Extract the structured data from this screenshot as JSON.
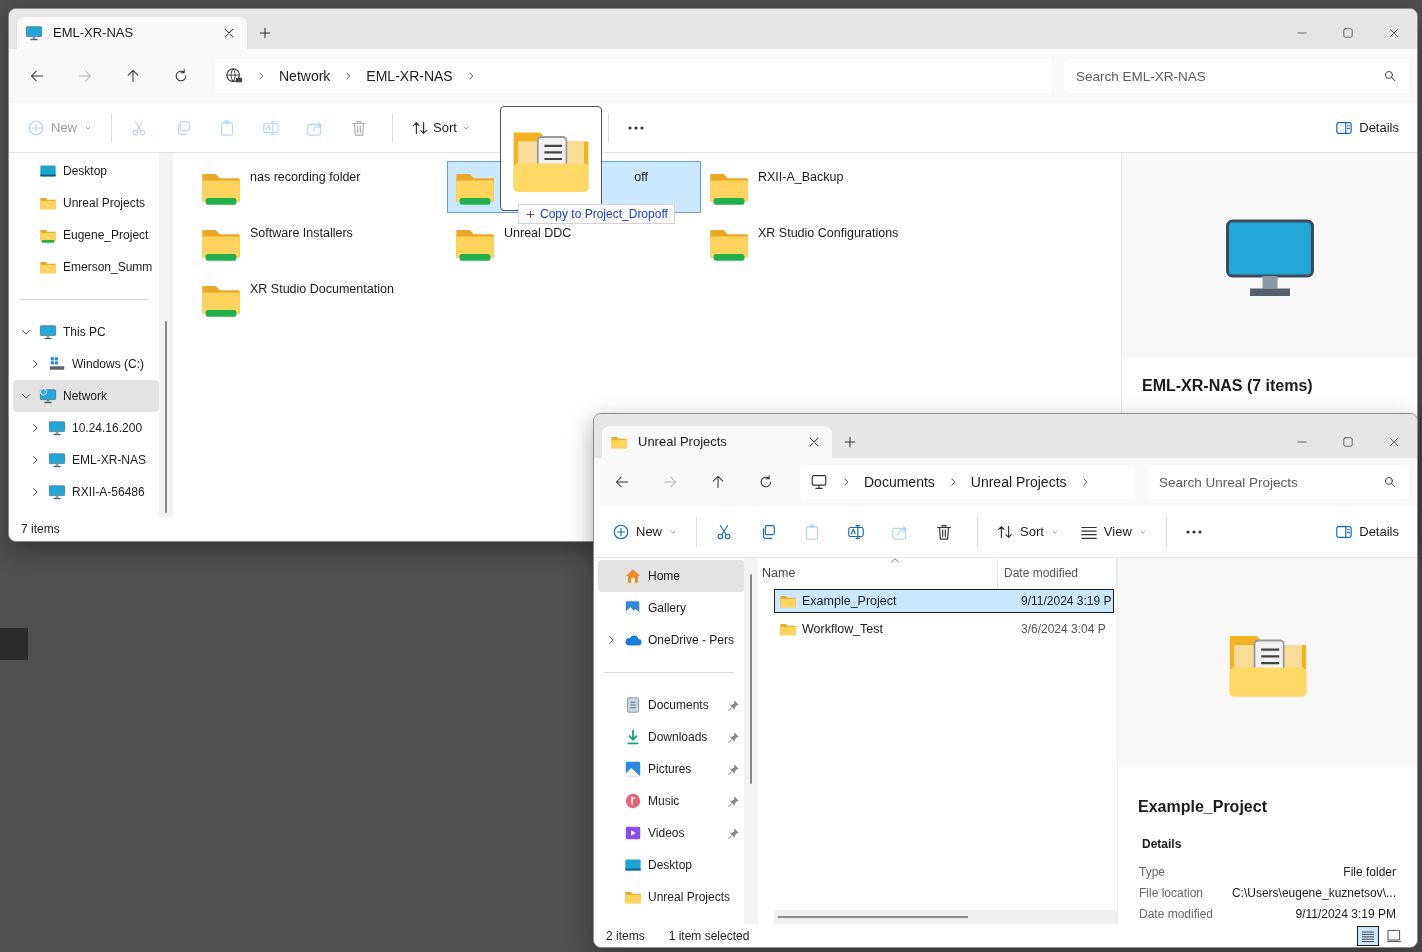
{
  "nas_window": {
    "tab": {
      "title": "EML-XR-NAS",
      "kind": "pc"
    },
    "nav_buttons": [
      {
        "kind": "back",
        "disabled": false
      },
      {
        "kind": "forward",
        "disabled": true
      },
      {
        "kind": "up",
        "disabled": false
      },
      {
        "kind": "refresh",
        "disabled": false
      }
    ],
    "breadcrumb": {
      "kind": "globe",
      "segments": [
        "Network",
        "EML-XR-NAS"
      ]
    },
    "search": {
      "placeholder": "Search EML-XR-NAS"
    },
    "command_groups": [
      [
        {
          "kind": "new",
          "label": "New",
          "disabled": true
        }
      ],
      [
        {
          "kind": "cut",
          "disabled": true
        },
        {
          "kind": "copy",
          "disabled": true
        },
        {
          "kind": "paste",
          "disabled": true
        },
        {
          "kind": "rename",
          "disabled": true
        },
        {
          "kind": "share",
          "disabled": true
        },
        {
          "kind": "delete",
          "disabled": true
        }
      ],
      [
        {
          "kind": "sort",
          "label": "Sort",
          "disabled": false
        }
      ],
      [
        {
          "kind": "more",
          "disabled": false
        }
      ]
    ],
    "details_button": {
      "label": "Details"
    },
    "sidebar": {
      "quick_access": [
        {
          "label": "Desktop",
          "kind": "desktop",
          "selected": false
        },
        {
          "label": "Unreal Projects",
          "kind": "folder",
          "selected": false
        },
        {
          "label": "Eugene_Project",
          "kind": "netfolder",
          "selected": false
        },
        {
          "label": "Emerson_Summ",
          "kind": "folder",
          "selected": false
        }
      ],
      "tree": [
        {
          "label": "This PC",
          "kind": "pc",
          "selected": false,
          "expanded": true,
          "children": [
            {
              "label": "Windows (C:)",
              "kind": "drive",
              "selected": false,
              "expanded": false
            }
          ]
        },
        {
          "label": "Network",
          "kind": "network",
          "selected": true,
          "expanded": true,
          "children": [
            {
              "label": "10.24.16.200",
              "kind": "pc",
              "selected": false,
              "expanded": false
            },
            {
              "label": "EML-XR-NAS",
              "kind": "pc",
              "selected": false,
              "expanded": false
            },
            {
              "label": "RXII-A-56486",
              "kind": "pc",
              "selected": false,
              "expanded": false
            }
          ]
        }
      ]
    },
    "tiles": [
      {
        "label": "nas recording folder",
        "selected": false
      },
      {
        "label": "off",
        "selected": true
      },
      {
        "label": "RXII-A_Backup",
        "selected": false
      },
      {
        "label": "Software Installers",
        "selected": false
      },
      {
        "label": "Unreal DDC",
        "selected": false
      },
      {
        "label": "XR Studio Configurations",
        "selected": false
      },
      {
        "label": "XR Studio Documentation",
        "selected": false
      }
    ],
    "details_pane": {
      "kind": "pc",
      "title": "EML-XR-NAS (7 items)"
    },
    "status_bar": [
      "7 items"
    ]
  },
  "drag": {
    "tooltip": "Copy to Project_Dropoff"
  },
  "projects_window": {
    "tab": {
      "title": "Unreal Projects",
      "kind": "folder"
    },
    "nav_buttons": [
      {
        "kind": "back",
        "disabled": false
      },
      {
        "kind": "forward",
        "disabled": true
      },
      {
        "kind": "up",
        "disabled": false
      },
      {
        "kind": "refresh",
        "disabled": false
      }
    ],
    "breadcrumb": {
      "kind": "monitor",
      "segments": [
        "Documents",
        "Unreal Projects"
      ]
    },
    "search": {
      "placeholder": "Search Unreal Projects"
    },
    "command_groups": [
      [
        {
          "kind": "new",
          "label": "New",
          "disabled": false
        }
      ],
      [
        {
          "kind": "cut",
          "disabled": false
        },
        {
          "kind": "copy",
          "disabled": false
        },
        {
          "kind": "paste",
          "disabled": true
        },
        {
          "kind": "rename",
          "disabled": false
        },
        {
          "kind": "share",
          "disabled": true
        },
        {
          "kind": "delete",
          "disabled": false
        }
      ],
      [
        {
          "kind": "sort",
          "label": "Sort",
          "disabled": false
        },
        {
          "kind": "view",
          "label": "View",
          "disabled": false
        }
      ],
      [
        {
          "kind": "more",
          "disabled": false
        }
      ]
    ],
    "details_button": {
      "label": "Details"
    },
    "sidebar": {
      "quick_access": [
        {
          "label": "Home",
          "kind": "home",
          "selected": true
        },
        {
          "label": "Gallery",
          "kind": "gallery",
          "selected": false
        }
      ],
      "tree": [
        {
          "label": "OneDrive - Pers",
          "kind": "onedrive",
          "selected": false,
          "expanded": false
        }
      ],
      "pinned": [
        {
          "label": "Documents",
          "kind": "documents",
          "selected": false,
          "pinned": true
        },
        {
          "label": "Downloads",
          "kind": "downloads",
          "selected": false,
          "pinned": true
        },
        {
          "label": "Pictures",
          "kind": "pictures",
          "selected": false,
          "pinned": true
        },
        {
          "label": "Music",
          "kind": "music",
          "selected": false,
          "pinned": true
        },
        {
          "label": "Videos",
          "kind": "videos",
          "selected": false,
          "pinned": true
        },
        {
          "label": "Desktop",
          "kind": "desktop",
          "selected": false,
          "pinned": false
        },
        {
          "label": "Unreal Projects",
          "kind": "folder",
          "selected": false,
          "pinned": false
        }
      ]
    },
    "table": {
      "columns": [
        "Name",
        "Date modified"
      ],
      "rows": [
        {
          "name": "Example_Project",
          "date": "9/11/2024 3:19 P",
          "selected": true
        },
        {
          "name": "Workflow_Test",
          "date": "3/6/2024 3:04 P",
          "selected": false
        }
      ]
    },
    "details_pane": {
      "title": "Example_Project",
      "heading": "Details",
      "fields": [
        {
          "label": "Type",
          "value": "File folder"
        },
        {
          "label": "File location",
          "value": "C:\\Users\\eugene_kuznetsov\\..."
        },
        {
          "label": "Date modified",
          "value": "9/11/2024 3:19 PM"
        }
      ]
    },
    "status_bar": [
      "2 items",
      "1 item selected"
    ],
    "view_modes": [
      {
        "kind": "details",
        "selected": true
      },
      {
        "kind": "preview",
        "selected": false
      }
    ]
  }
}
